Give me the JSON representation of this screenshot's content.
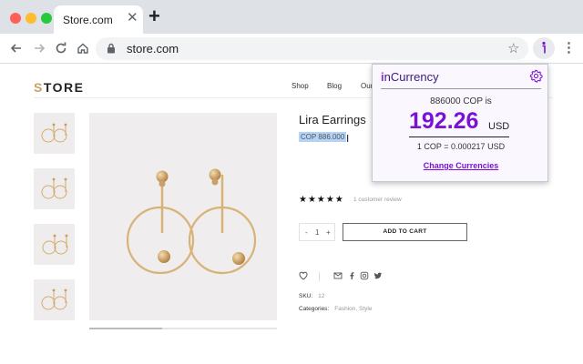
{
  "browser": {
    "window_controls": [
      {
        "name": "close",
        "color": "#ff5f57"
      },
      {
        "name": "minimize",
        "color": "#febc2e"
      },
      {
        "name": "maximize",
        "color": "#28c840"
      }
    ],
    "tab": {
      "title": "Store.com",
      "close": "✕"
    },
    "new_tab": "+",
    "url": "store.com"
  },
  "store": {
    "logo_first": "S",
    "logo_rest": "TORE",
    "menu": [
      "Shop",
      "Blog",
      "Our"
    ],
    "product": {
      "title": "Lira Earrings",
      "price": "COP 886.000",
      "rating": 5,
      "stars": "★★★★★",
      "review": "1 customer review",
      "qty_minus": "-",
      "qty_value": "1",
      "qty_plus": "+",
      "add_to_cart": "ADD TO CART",
      "sku_label": "SKU:",
      "sku_value": "12",
      "categories_label": "Categories:",
      "categories_value": "Fashion, Style"
    },
    "accent_color": "#c9a06a"
  },
  "extension": {
    "brand_mark": "i",
    "brand_name": "nCurrency",
    "source": "886000 COP is",
    "value": "192.26",
    "currency": "USD",
    "rate": "1 COP = 0.000217 USD",
    "link": "Change Currencies",
    "accent_color": "#7a12d6"
  }
}
